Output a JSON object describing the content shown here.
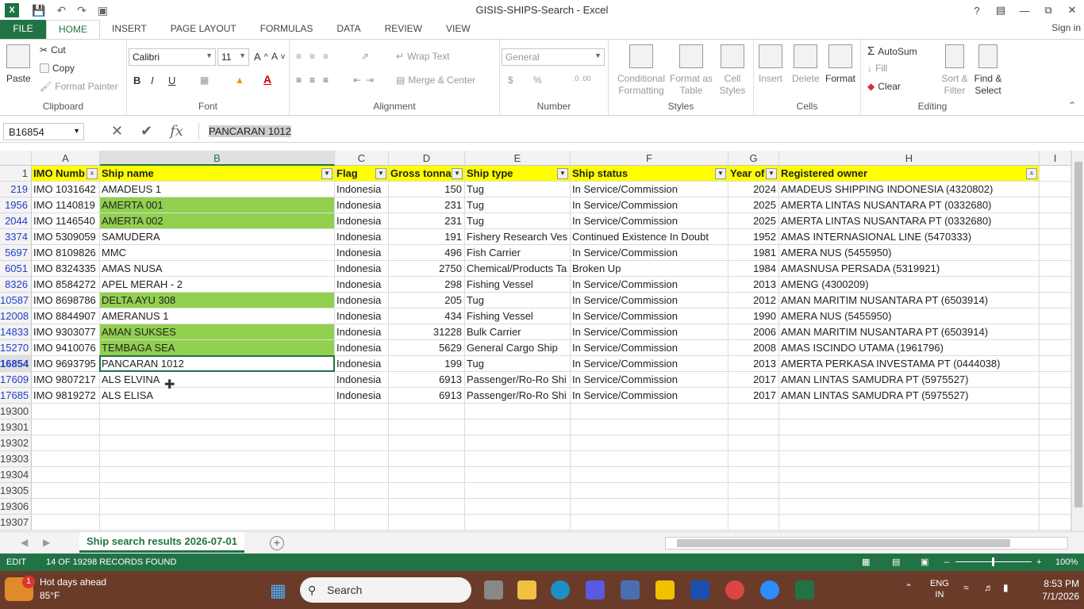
{
  "window": {
    "title": "GISIS-SHIPS-Search - Excel",
    "app_icon": "X"
  },
  "ribbon_tabs": [
    "FILE",
    "HOME",
    "INSERT",
    "PAGE LAYOUT",
    "FORMULAS",
    "DATA",
    "REVIEW",
    "VIEW"
  ],
  "sign_in": "Sign in",
  "clipboard": {
    "paste": "Paste",
    "cut": "Cut",
    "copy": "Copy",
    "format_painter": "Format Painter",
    "label": "Clipboard"
  },
  "font": {
    "name": "Calibri",
    "size": "11",
    "label": "Font",
    "bold": "B",
    "italic": "I",
    "underline": "U"
  },
  "alignment": {
    "wrap": "Wrap Text",
    "merge": "Merge & Center",
    "label": "Alignment"
  },
  "number": {
    "format": "General",
    "label": "Number",
    "currency": "$",
    "percent": "%"
  },
  "styles": {
    "conditional": "Conditional Formatting",
    "format_table": "Format as Table",
    "cell_styles": "Cell Styles",
    "label": "Styles"
  },
  "cells": {
    "insert": "Insert",
    "delete": "Delete",
    "format": "Format",
    "label": "Cells"
  },
  "editing": {
    "autosum": "AutoSum",
    "fill": "Fill",
    "clear": "Clear",
    "sort": "Sort & Filter",
    "find": "Find & Select",
    "label": "Editing"
  },
  "formula_bar": {
    "name_box": "B16854",
    "fx": "fx",
    "content": "PANCARAN 1012"
  },
  "columns": [
    "A",
    "B",
    "C",
    "D",
    "E",
    "F",
    "G",
    "H",
    "I"
  ],
  "header_row": {
    "num": "1",
    "cells": [
      "IMO Numb",
      "Ship name",
      "Flag",
      "Gross tonna",
      "Ship type",
      "Ship status",
      "Year of",
      "Registered owner"
    ]
  },
  "rows": [
    {
      "num": "219",
      "cells": [
        "IMO 1031642",
        "AMADEUS 1",
        "Indonesia",
        "150",
        "Tug",
        "In Service/Commission",
        "2024",
        "AMADEUS SHIPPING INDONESIA (4320802)"
      ],
      "green": false
    },
    {
      "num": "1956",
      "cells": [
        "IMO 1140819",
        "AMERTA 001",
        "Indonesia",
        "231",
        "Tug",
        "In Service/Commission",
        "2025",
        "AMERTA LINTAS NUSANTARA PT (0332680)"
      ],
      "green": true
    },
    {
      "num": "2044",
      "cells": [
        "IMO 1146540",
        "AMERTA 002",
        "Indonesia",
        "231",
        "Tug",
        "In Service/Commission",
        "2025",
        "AMERTA LINTAS NUSANTARA PT (0332680)"
      ],
      "green": true
    },
    {
      "num": "3374",
      "cells": [
        "IMO 5309059",
        "SAMUDERA",
        "Indonesia",
        "191",
        "Fishery Research Ves",
        "Continued Existence In Doubt",
        "1952",
        "AMAS INTERNASIONAL LINE (5470333)"
      ],
      "green": false
    },
    {
      "num": "5697",
      "cells": [
        "IMO 8109826",
        "MMC",
        "Indonesia",
        "496",
        "Fish Carrier",
        "In Service/Commission",
        "1981",
        "AMERA NUS (5455950)"
      ],
      "green": false
    },
    {
      "num": "6051",
      "cells": [
        "IMO 8324335",
        "AMAS NUSA",
        "Indonesia",
        "2750",
        "Chemical/Products Ta",
        "Broken Up",
        "1984",
        "AMASNUSA PERSADA (5319921)"
      ],
      "green": false
    },
    {
      "num": "8326",
      "cells": [
        "IMO 8584272",
        "APEL MERAH - 2",
        "Indonesia",
        "298",
        "Fishing Vessel",
        "In Service/Commission",
        "2013",
        "AMENG (4300209)"
      ],
      "green": false
    },
    {
      "num": "10587",
      "cells": [
        "IMO 8698786",
        "DELTA AYU 308",
        "Indonesia",
        "205",
        "Tug",
        "In Service/Commission",
        "2012",
        "AMAN MARITIM NUSANTARA PT (6503914)"
      ],
      "green": true
    },
    {
      "num": "12008",
      "cells": [
        "IMO 8844907",
        "AMERANUS 1",
        "Indonesia",
        "434",
        "Fishing Vessel",
        "In Service/Commission",
        "1990",
        "AMERA NUS (5455950)"
      ],
      "green": false
    },
    {
      "num": "14833",
      "cells": [
        "IMO 9303077",
        "AMAN SUKSES",
        "Indonesia",
        "31228",
        "Bulk Carrier",
        "In Service/Commission",
        "2006",
        "AMAN MARITIM NUSANTARA PT (6503914)"
      ],
      "green": true
    },
    {
      "num": "15270",
      "cells": [
        "IMO 9410076",
        "TEMBAGA SEA",
        "Indonesia",
        "5629",
        "General Cargo Ship",
        "In Service/Commission",
        "2008",
        "AMAS ISCINDO UTAMA (1961796)"
      ],
      "green": true
    },
    {
      "num": "16854",
      "cells": [
        "IMO 9693795",
        "PANCARAN 1012",
        "Indonesia",
        "199",
        "Tug",
        "In Service/Commission",
        "2013",
        "AMERTA PERKASA INVESTAMA PT (0444038)"
      ],
      "green": false
    },
    {
      "num": "17609",
      "cells": [
        "IMO 9807217",
        "ALS ELVINA",
        "Indonesia",
        "6913",
        "Passenger/Ro-Ro Shi",
        "In Service/Commission",
        "2017",
        "AMAN LINTAS SAMUDRA PT (5975527)"
      ],
      "green": false
    },
    {
      "num": "17685",
      "cells": [
        "IMO 9819272",
        "ALS ELISA",
        "Indonesia",
        "6913",
        "Passenger/Ro-Ro Shi",
        "In Service/Commission",
        "2017",
        "AMAN LINTAS SAMUDRA PT (5975527)"
      ],
      "green": false
    }
  ],
  "empty_rows": [
    "19300",
    "19301",
    "19302",
    "19303",
    "19304",
    "19305",
    "19306",
    "19307"
  ],
  "sheet_tab": "Ship search results 2026-07-01",
  "status": {
    "mode": "EDIT",
    "message": "14 OF 19298 RECORDS FOUND",
    "zoom": "100%"
  },
  "taskbar": {
    "weather_title": "Hot days ahead",
    "weather_temp": "85°F",
    "badge": "1",
    "search": "Search",
    "lang": "ENG",
    "lang2": "IN",
    "time": "8:53 PM",
    "date": "7/1/2026"
  },
  "colors": {
    "accent": "#217346",
    "header_fill": "#ffff00",
    "highlight_fill": "#92d050"
  }
}
